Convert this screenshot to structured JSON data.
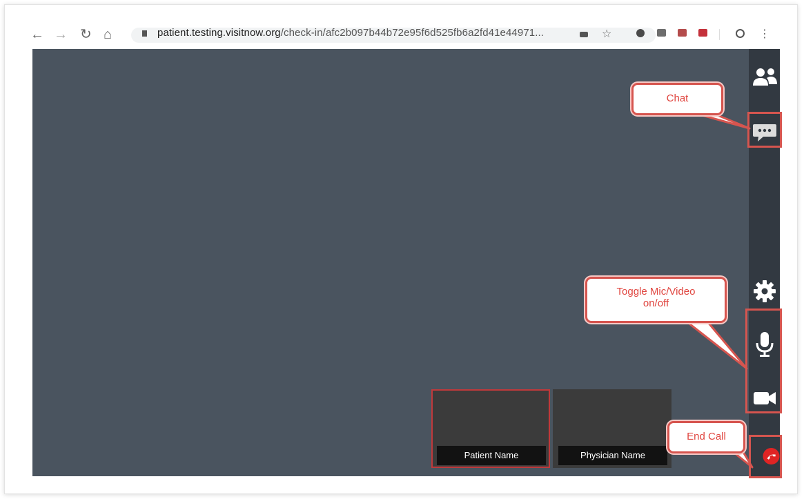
{
  "browser": {
    "url_domain": "patient.testing.visitnow.org",
    "url_path": "/check-in/afc2b097b44b72e95f6d525fb6a2fd41e44971..."
  },
  "participants": [
    {
      "label": "Patient Name"
    },
    {
      "label": "Physician Name"
    }
  ],
  "sidebar": {
    "items": [
      {
        "icon": "participants-icon"
      },
      {
        "icon": "chat-icon"
      },
      {
        "icon": "settings-icon"
      },
      {
        "icon": "microphone-icon"
      },
      {
        "icon": "camera-icon"
      },
      {
        "icon": "end-call-icon"
      }
    ]
  },
  "callouts": {
    "chat": "Chat",
    "toggle_line1": "Toggle Mic/Video",
    "toggle_line2": "on/off",
    "end_call": "End Call"
  },
  "colors": {
    "stage_bg": "#4a545f",
    "sidebar_bg": "#323941",
    "highlight": "#d6554f",
    "end_call": "#e02424"
  }
}
